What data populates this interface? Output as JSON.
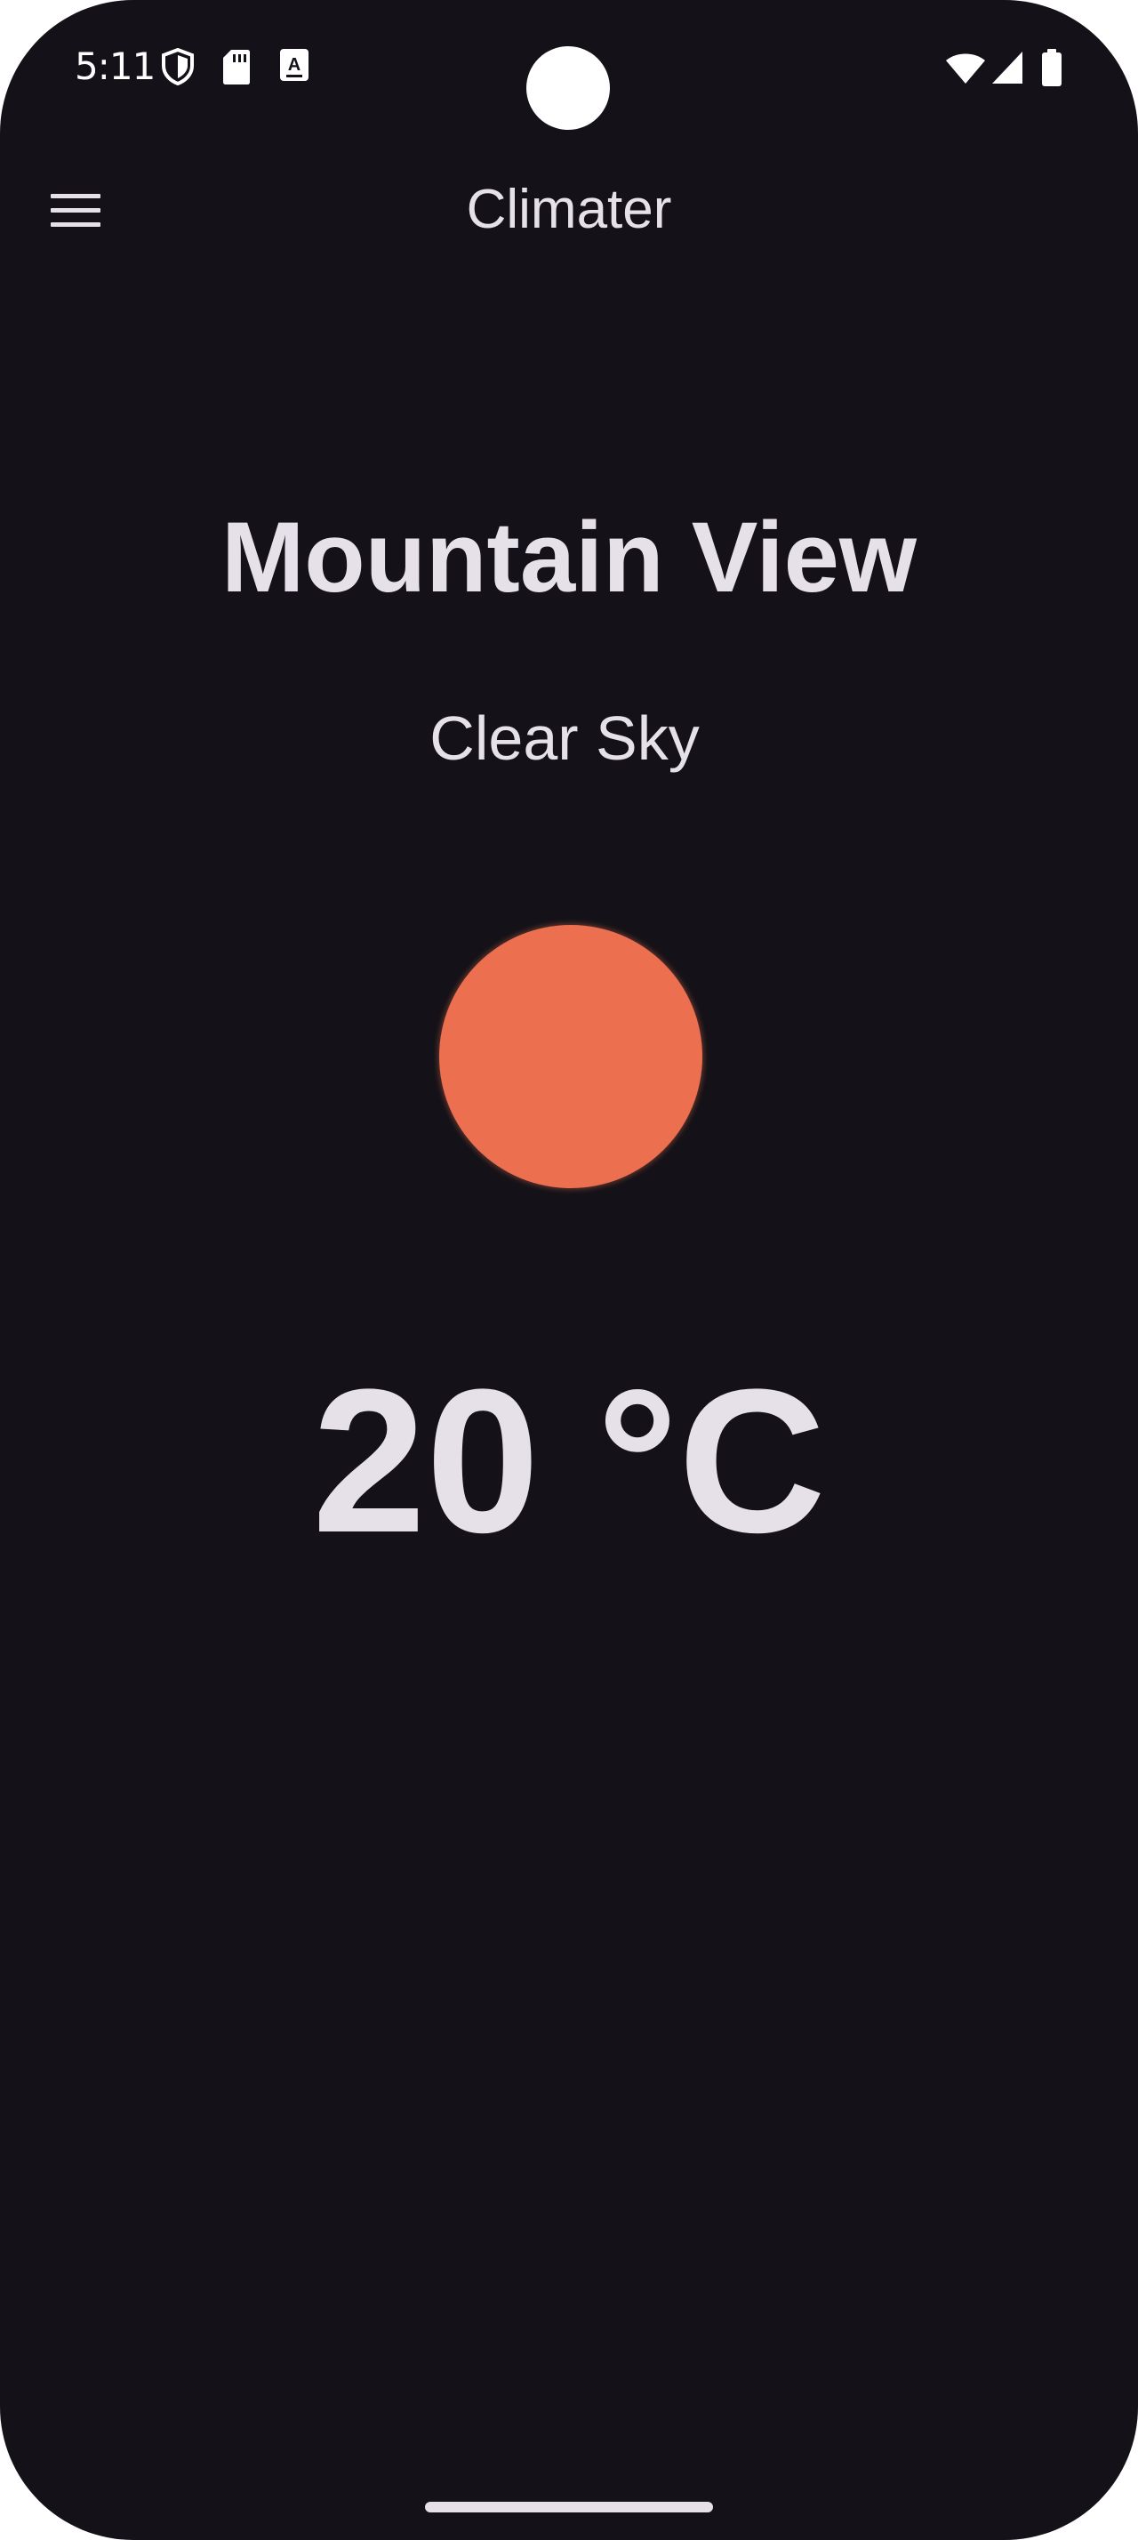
{
  "status_bar": {
    "time": "5:11",
    "icons": [
      "shield-icon",
      "sd-card-icon",
      "keyboard-a-icon",
      "wifi-icon",
      "signal-icon",
      "battery-icon"
    ]
  },
  "app_bar": {
    "title": "Climater",
    "menu_icon": "hamburger-menu-icon"
  },
  "weather": {
    "city": "Mountain View",
    "condition": "Clear Sky",
    "icon": "sun-icon",
    "icon_color": "#ec6f50",
    "temperature": "20 °C"
  },
  "colors": {
    "background": "#141218",
    "text": "#e6e0e9",
    "accent": "#ec6f50"
  }
}
